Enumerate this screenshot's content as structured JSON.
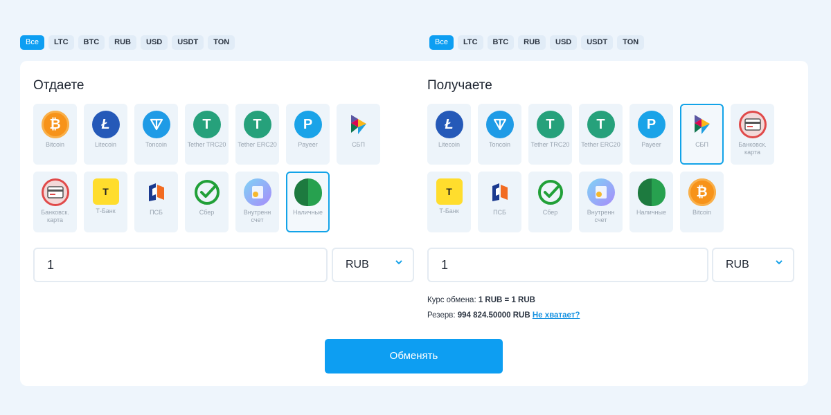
{
  "filters": {
    "left": [
      "Все",
      "LTC",
      "BTC",
      "RUB",
      "USD",
      "USDT",
      "TON"
    ],
    "right": [
      "Все",
      "LTC",
      "BTC",
      "RUB",
      "USD",
      "USDT",
      "TON"
    ],
    "active": "Все"
  },
  "give": {
    "title": "Отдаете",
    "items": [
      {
        "label": "Bitcoin",
        "icon": "bitcoin-icon"
      },
      {
        "label": "Litecoin",
        "icon": "litecoin-icon"
      },
      {
        "label": "Toncoin",
        "icon": "toncoin-icon"
      },
      {
        "label": "Tether TRC20",
        "icon": "tether-icon"
      },
      {
        "label": "Tether ERC20",
        "icon": "tether-icon"
      },
      {
        "label": "Payeer",
        "icon": "payeer-icon"
      },
      {
        "label": "СБП",
        "icon": "sbp-icon"
      },
      {
        "label": "Банковск. карта",
        "icon": "bank-card-icon"
      },
      {
        "label": "Т-Банк",
        "icon": "tbank-icon"
      },
      {
        "label": "ПСБ",
        "icon": "psb-icon"
      },
      {
        "label": "Сбер",
        "icon": "sber-icon"
      },
      {
        "label": "Внутренн счет",
        "icon": "internal-account-icon"
      },
      {
        "label": "Наличные",
        "icon": "cash-icon"
      }
    ],
    "selected": "Наличные",
    "amount": "1",
    "currency": "RUB"
  },
  "receive": {
    "title": "Получаете",
    "items": [
      {
        "label": "Litecoin",
        "icon": "litecoin-icon"
      },
      {
        "label": "Toncoin",
        "icon": "toncoin-icon"
      },
      {
        "label": "Tether TRC20",
        "icon": "tether-icon"
      },
      {
        "label": "Tether ERC20",
        "icon": "tether-icon"
      },
      {
        "label": "Payeer",
        "icon": "payeer-icon"
      },
      {
        "label": "СБП",
        "icon": "sbp-icon"
      },
      {
        "label": "Банковск. карта",
        "icon": "bank-card-icon"
      },
      {
        "label": "Т-Банк",
        "icon": "tbank-icon"
      },
      {
        "label": "ПСБ",
        "icon": "psb-icon"
      },
      {
        "label": "Сбер",
        "icon": "sber-icon"
      },
      {
        "label": "Внутренн счет",
        "icon": "internal-account-icon"
      },
      {
        "label": "Наличные",
        "icon": "cash-icon"
      },
      {
        "label": "Bitcoin",
        "icon": "bitcoin-icon"
      }
    ],
    "selected": "СБП",
    "amount": "1",
    "currency": "RUB"
  },
  "rate": {
    "label": "Курс обмена:",
    "value": "1 RUB = 1 RUB"
  },
  "reserve": {
    "label": "Резерв:",
    "value": "994 824.50000 RUB",
    "link": "Не хватает?"
  },
  "submit_label": "Обменять",
  "colors": {
    "accent": "#0d9ef2",
    "page_bg": "#eef5fc",
    "tile_bg": "#edf4fa"
  }
}
